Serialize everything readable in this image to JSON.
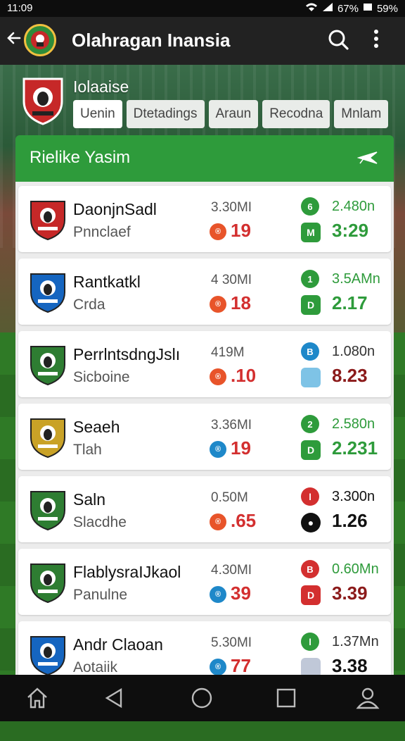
{
  "status_bar": {
    "time": "11:09",
    "battery": "59%",
    "signal_text": "67%"
  },
  "app_bar": {
    "title": "Olahragan Inansia",
    "back_icon": "arrow-left-icon",
    "search_icon": "search-icon",
    "more_icon": "more-vertical-icon"
  },
  "section": {
    "label": "Iolaaise"
  },
  "tabs": [
    {
      "label": "Uenin"
    },
    {
      "label": "Dtetadings"
    },
    {
      "label": "Araun"
    },
    {
      "label": "Recodna"
    },
    {
      "label": "Mnlam"
    }
  ],
  "panel": {
    "title": "Rielike Yasim",
    "icon": "plane-icon"
  },
  "rows": [
    {
      "name": "DaonjnSadl",
      "sub": "Pnnclaef",
      "amount": "3.30MI",
      "score": "19",
      "score_color": "#d32f2f",
      "score_icon_color": "#e8542a",
      "odds": "2.480n",
      "odds_color": "#2e9b3b",
      "value": "3:29",
      "value_color": "#2e9b3b",
      "r_icon_color": "#2e9b3b",
      "r_icon2_color": "#2e9b3b",
      "s_icon_text": "®",
      "r_icon_text": "6",
      "r_icon2_text": "M",
      "crest": "#c62828"
    },
    {
      "name": "Rantkatkl",
      "sub": "Crda",
      "amount": "4 30MI",
      "score": "18",
      "score_color": "#d32f2f",
      "score_icon_color": "#e8542a",
      "odds": "3.5AMn",
      "odds_color": "#2e9b3b",
      "value": "2.17",
      "value_color": "#2e9b3b",
      "r_icon_color": "#2e9b3b",
      "r_icon2_color": "#2e9b3b",
      "s_icon_text": "®",
      "r_icon_text": "1",
      "r_icon2_text": "D",
      "crest": "#1565c0"
    },
    {
      "name": "PerrlntsdngJslı",
      "sub": "Sicboine",
      "amount": "419M",
      "score": ".10",
      "score_color": "#d32f2f",
      "score_icon_color": "#e8542a",
      "odds": "1.080n",
      "odds_color": "#333333",
      "value": "8.23",
      "value_color": "#8b1a1a",
      "r_icon_color": "#1e88c9",
      "r_icon2_color": "#7ec3e6",
      "s_icon_text": "®",
      "r_icon_text": "B",
      "r_icon2_text": "",
      "crest": "#2e7d32"
    },
    {
      "name": "Seaeh",
      "sub": "Tlah",
      "amount": "3.36MI",
      "score": "19",
      "score_color": "#d32f2f",
      "score_icon_color": "#1e88c9",
      "odds": "2.580n",
      "odds_color": "#2e9b3b",
      "value": "2.231",
      "value_color": "#2e9b3b",
      "r_icon_color": "#2e9b3b",
      "r_icon2_color": "#2e9b3b",
      "s_icon_text": "®",
      "r_icon_text": "2",
      "r_icon2_text": "D",
      "crest": "#c9a227"
    },
    {
      "name": "Saln",
      "sub": "Slacdhe",
      "amount": "0.50M",
      "score": ".65",
      "score_color": "#d32f2f",
      "score_icon_color": "#e8542a",
      "odds": "3.300n",
      "odds_color": "#111111",
      "value": "1.26",
      "value_color": "#111111",
      "r_icon_color": "#d32f2f",
      "r_icon2_color": "#111111",
      "s_icon_text": "®",
      "r_icon_text": "l",
      "r_icon2_text": "●",
      "crest": "#2e7d32"
    },
    {
      "name": "FlablysraIJkaol",
      "sub": "Panulne",
      "amount": "4.30MI",
      "score": "39",
      "score_color": "#d32f2f",
      "score_icon_color": "#1e88c9",
      "odds": "0.60Mn",
      "odds_color": "#2e9b3b",
      "value": "3.39",
      "value_color": "#8b1a1a",
      "r_icon_color": "#d32f2f",
      "r_icon2_color": "#d32f2f",
      "s_icon_text": "®",
      "r_icon_text": "B",
      "r_icon2_text": "D",
      "crest": "#2e7d32"
    },
    {
      "name": "Andr Claoan",
      "sub": "Aotaiik",
      "amount": "5.30MI",
      "score": "77",
      "score_color": "#d32f2f",
      "score_icon_color": "#1e88c9",
      "odds": "1.37Mn",
      "odds_color": "#333333",
      "value": "3.38",
      "value_color": "#111111",
      "r_icon_color": "#2e9b3b",
      "r_icon2_color": "#c0c8d8",
      "s_icon_text": "®",
      "r_icon_text": "l",
      "r_icon2_text": "",
      "crest": "#1565c0"
    }
  ],
  "nav": {
    "items": [
      "home-icon",
      "back-triangle-icon",
      "circle-home-icon",
      "square-recents-icon",
      "profile-icon"
    ]
  }
}
